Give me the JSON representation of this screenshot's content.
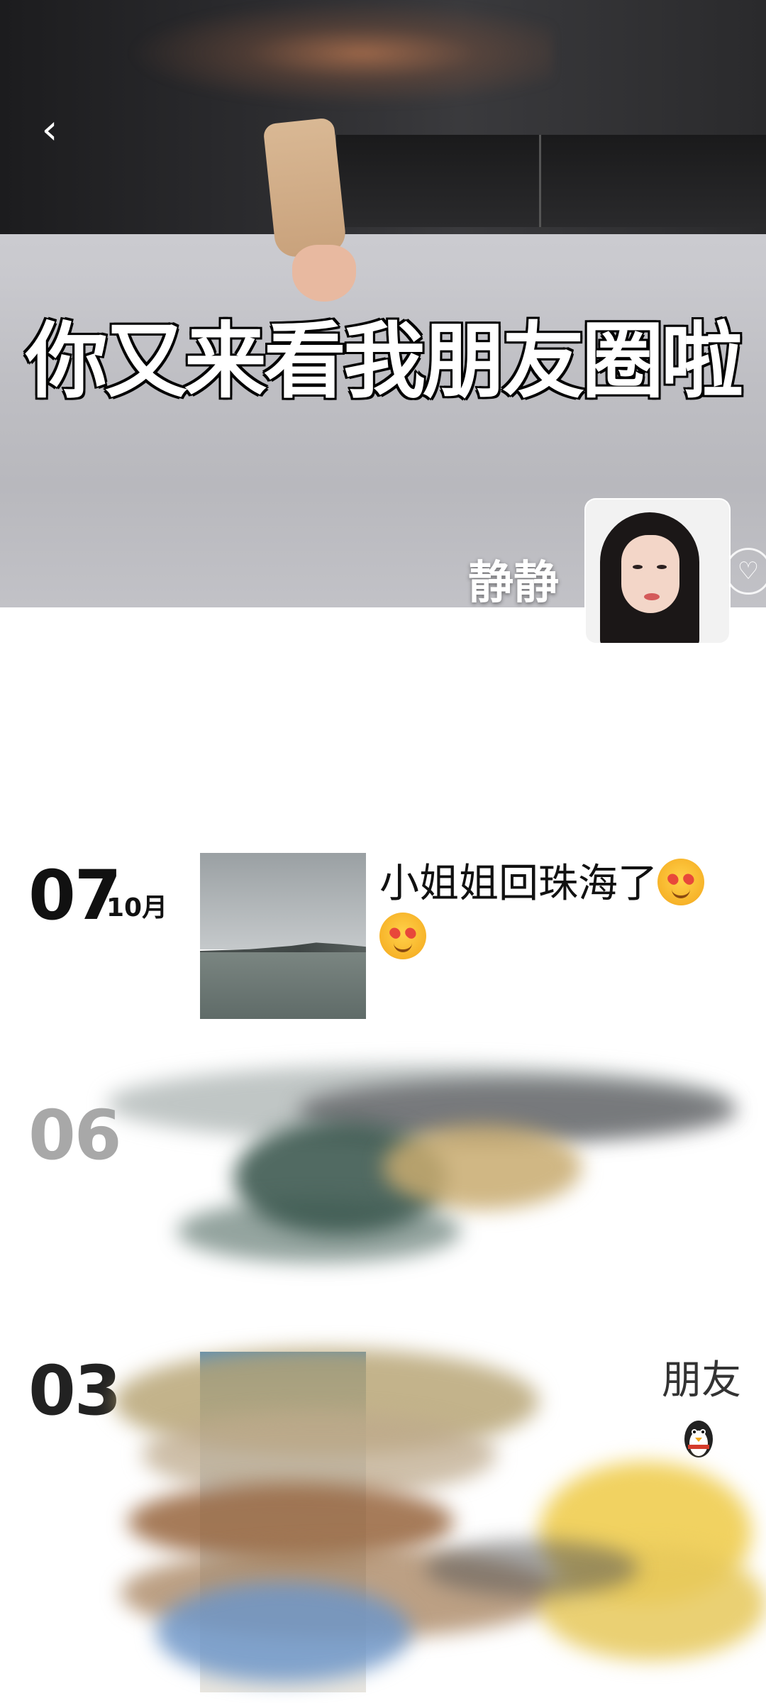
{
  "cover": {
    "caption": "你又来看我朋友圈啦",
    "username": "静静",
    "back_icon": "chevron-left-icon",
    "like_icon": "heart-icon"
  },
  "posts": [
    {
      "day": "07",
      "month": "10月",
      "text": "小姐姐回珠海了",
      "emoji": "star-struck-face"
    },
    {
      "day": "06",
      "month": "",
      "text": ""
    },
    {
      "day": "03",
      "month": "",
      "text": "朋友",
      "emoji": "penguin"
    }
  ]
}
